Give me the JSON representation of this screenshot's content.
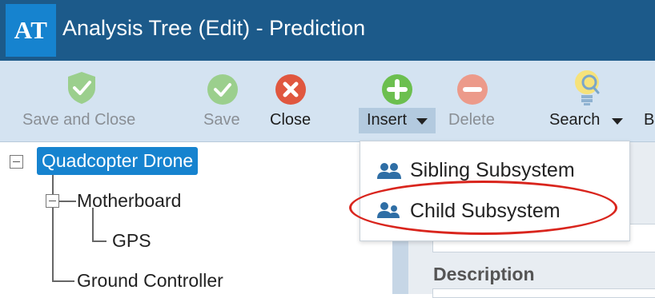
{
  "window": {
    "logo_text": "AT",
    "title": "Analysis Tree (Edit) - Prediction"
  },
  "toolbar": {
    "save_and_close_label": "Save and Close",
    "save_label": "Save",
    "close_label": "Close",
    "insert_label": "Insert",
    "delete_label": "Delete",
    "search_label": "Search",
    "truncated_label": "B"
  },
  "tree": {
    "nodes": [
      {
        "label": "Quadcopter Drone",
        "selected": true
      },
      {
        "label": "Motherboard"
      },
      {
        "label": "GPS"
      },
      {
        "label": "Ground Controller"
      }
    ]
  },
  "insert_menu": {
    "items": [
      {
        "label": "Sibling Subsystem",
        "icon": "people-icon"
      },
      {
        "label": "Child Subsystem",
        "icon": "people-icon",
        "annotated": true
      }
    ]
  },
  "details": {
    "description_label": "Description"
  },
  "colors": {
    "titlebar": "#1c5a8a",
    "logo": "#1683cf",
    "toolbar": "#d4e3f1",
    "selection": "#1683cf",
    "annotation": "#d9251d"
  }
}
